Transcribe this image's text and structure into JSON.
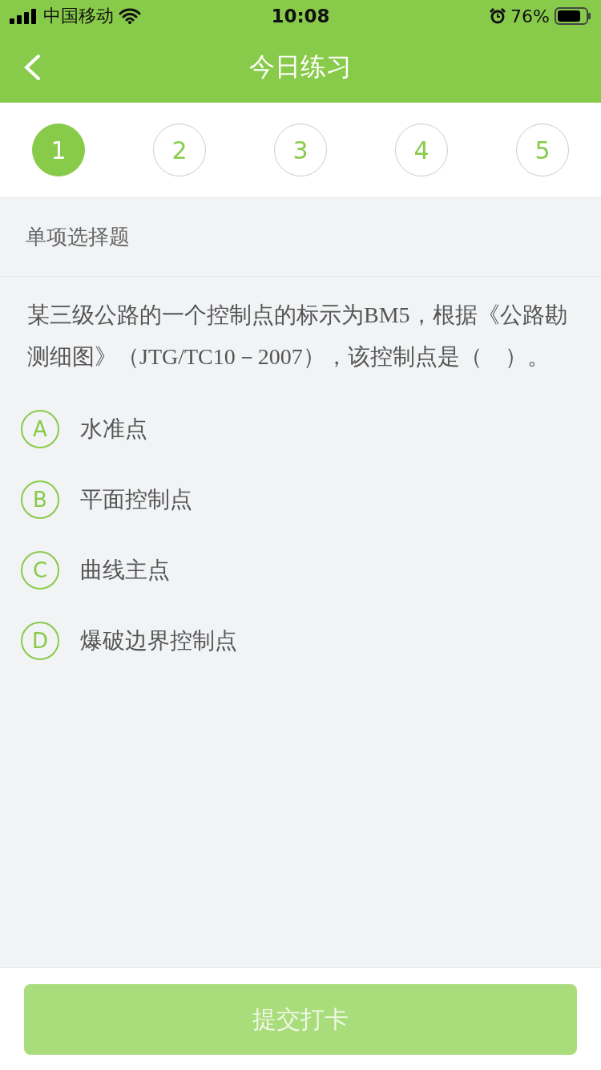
{
  "status_bar": {
    "carrier": "中国移动",
    "time": "10:08",
    "battery": "76%"
  },
  "nav_bar": {
    "title": "今日练习"
  },
  "question_tabs": [
    {
      "label": "1",
      "selected": true
    },
    {
      "label": "2",
      "selected": false
    },
    {
      "label": "3",
      "selected": false
    },
    {
      "label": "4",
      "selected": false
    },
    {
      "label": "5",
      "selected": false
    }
  ],
  "question": {
    "type": "单项选择题",
    "text": "某三级公路的一个控制点的标示为BM5，根据《公路勘测细图》（JTG/TC10－2007），该控制点是（　）。",
    "options": [
      {
        "letter": "A",
        "text": "水准点",
        "selected": false
      },
      {
        "letter": "B",
        "text": "平面控制点",
        "selected": false
      },
      {
        "letter": "C",
        "text": "曲线主点",
        "selected": false
      },
      {
        "letter": "D",
        "text": "爆破边界控制点",
        "selected": false
      }
    ]
  },
  "submit_button": {
    "label": "提交打卡",
    "disabled": true
  }
}
